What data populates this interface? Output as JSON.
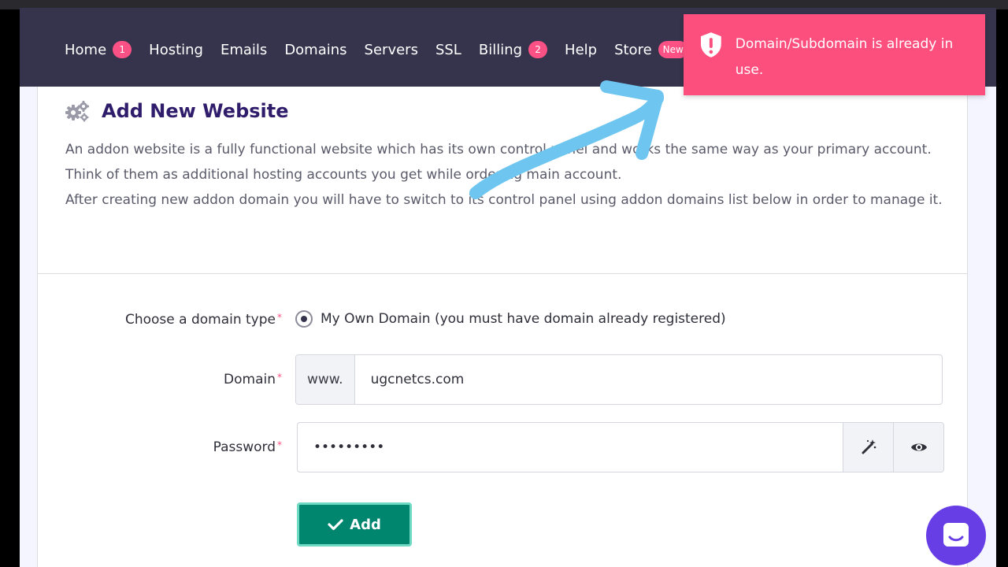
{
  "nav": {
    "items": [
      {
        "label": "Home",
        "badge": "1"
      },
      {
        "label": "Hosting"
      },
      {
        "label": "Emails"
      },
      {
        "label": "Domains"
      },
      {
        "label": "Servers"
      },
      {
        "label": "SSL"
      },
      {
        "label": "Billing",
        "badge": "2"
      },
      {
        "label": "Help"
      },
      {
        "label": "Store",
        "badge": "New"
      }
    ]
  },
  "card": {
    "title": "Add New Website",
    "description": [
      "An addon website is a fully functional website which has its own control panel and works the same way as your primary account.",
      "Think of them as additional hosting accounts you get while ordering main account.",
      "After creating new addon domain you will have to switch to its control panel using addon domains list below in order to manage it."
    ]
  },
  "form": {
    "domain_type_label": "Choose a domain type",
    "domain_type_option": "My Own Domain (you must have domain already registered)",
    "domain_label": "Domain",
    "domain_prefix": "www.",
    "domain_value": "ugcnetcs.com",
    "password_label": "Password",
    "password_value": "•••••••••",
    "required_mark": "*",
    "add_label": "Add"
  },
  "toast": {
    "message": "Domain/Subdomain is already in use."
  },
  "colors": {
    "navbar": "#36344d",
    "accent_pink": "#fc5185",
    "button_green": "#00856f",
    "chat_purple": "#673de6",
    "annotation_arrow": "#6ec6f0"
  },
  "icons": {
    "title": "gears-icon",
    "toast": "shield-alert-icon",
    "generate": "magic-wand-icon",
    "visibility": "eye-icon",
    "add": "check-icon",
    "chat": "chat-icon"
  }
}
